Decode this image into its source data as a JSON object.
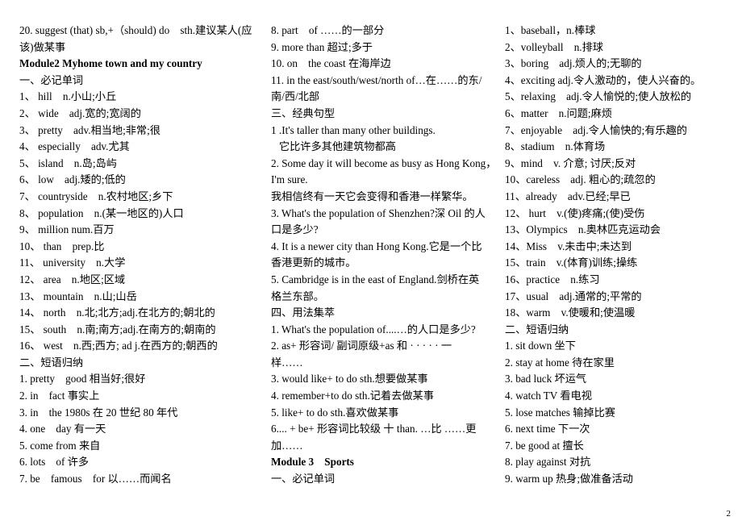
{
  "document": {
    "page_number": "2",
    "columns": [
      {
        "id": "column-left",
        "lines": [
          {
            "text": "20. suggest (that) sb,+（should) do    sth.建议某人(应",
            "bold": false
          },
          {
            "text": "该)做某事",
            "bold": false
          },
          {
            "text": "Module2 Myhome town and my country",
            "bold": true
          },
          {
            "text": "一、必记单词",
            "bold": false
          },
          {
            "text": "1、 hill    n.小山;小丘",
            "bold": false
          },
          {
            "text": "2、 wide    adj.宽的;宽阔的",
            "bold": false
          },
          {
            "text": "3、 pretty    adv.相当地;非常;很",
            "bold": false
          },
          {
            "text": "4、 especially    adv.尤其",
            "bold": false
          },
          {
            "text": "5、 island    n.岛;岛屿",
            "bold": false
          },
          {
            "text": "6、 low    adj.矮的;低的",
            "bold": false
          },
          {
            "text": "7、 countryside    n.农村地区;乡下",
            "bold": false
          },
          {
            "text": "8、 population    n.(某一地区的)人口",
            "bold": false
          },
          {
            "text": "9、 million num.百万",
            "bold": false
          },
          {
            "text": "10、 than    prep.比",
            "bold": false
          },
          {
            "text": "11、 university    n.大学",
            "bold": false
          },
          {
            "text": "12、 area    n.地区;区域",
            "bold": false
          },
          {
            "text": "13、 mountain    n.山;山岳",
            "bold": false
          },
          {
            "text": "14、 north    n.北;北方;adj.在北方的;朝北的",
            "bold": false
          },
          {
            "text": "15、 south    n.南;南方;adj.在南方的;朝南的",
            "bold": false
          },
          {
            "text": "16、 west    n.西;西方; ad j.在西方的;朝西的",
            "bold": false
          },
          {
            "text": "二、短语归纳",
            "bold": false
          },
          {
            "text": "1. pretty    good 相当好;很好",
            "bold": false
          },
          {
            "text": "2. in    fact 事实上",
            "bold": false
          },
          {
            "text": "3. in    the 1980s 在 20 世纪 80 年代",
            "bold": false
          },
          {
            "text": "4. one    day 有一天",
            "bold": false
          },
          {
            "text": "5. come from 来自",
            "bold": false
          },
          {
            "text": "6. lots    of 许多",
            "bold": false
          },
          {
            "text": "7. be    famous    for 以……而闻名",
            "bold": false
          }
        ]
      },
      {
        "id": "column-middle",
        "lines": [
          {
            "text": "8. part    of ……的一部分",
            "bold": false
          },
          {
            "text": "9. more than 超过;多于",
            "bold": false
          },
          {
            "text": "10. on    the coast 在海岸边",
            "bold": false
          },
          {
            "text": "11. in the east/south/west/north of…在……的东/",
            "bold": false
          },
          {
            "text": "南/西/北部",
            "bold": false
          },
          {
            "text": "三、经典句型",
            "bold": false
          },
          {
            "text": "1 .It's taller than many other buildings.",
            "bold": false
          },
          {
            "text": "   它比许多其他建筑物都高",
            "bold": false
          },
          {
            "text": "2. Some day it will become as busy as Hong Kong，",
            "bold": false
          },
          {
            "text": "I'm sure.",
            "bold": false
          },
          {
            "text": "我相信终有一天它会变得和香港一样繁华。",
            "bold": false
          },
          {
            "text": "3. What's the population of Shenzhen?深 Oil 的人",
            "bold": false
          },
          {
            "text": "口是多少?",
            "bold": false
          },
          {
            "text": "4. It is a newer city than Hong Kong.它是一个比",
            "bold": false
          },
          {
            "text": "香港更新的城市。",
            "bold": false
          },
          {
            "text": "5. Cambridge is in the east of England.剑桥在英",
            "bold": false
          },
          {
            "text": "格兰东部。",
            "bold": false
          },
          {
            "text": "四、用法集萃",
            "bold": false
          },
          {
            "text": "1. What's the population of....…的人口是多少?",
            "bold": false
          },
          {
            "text": "2. as+ 形容词/ 副词原级+as 和 · · · · · 一",
            "bold": false
          },
          {
            "text": "样……",
            "bold": false
          },
          {
            "text": "3. would like+ to do sth.想要做某事",
            "bold": false
          },
          {
            "text": "4. remember+to do sth.记着去做某事",
            "bold": false
          },
          {
            "text": "5. like+ to do sth.喜欢做某事",
            "bold": false
          },
          {
            "text": "6.... + be+ 形容词比较级 十 than. …比 ……更",
            "bold": false
          },
          {
            "text": "加……",
            "bold": false
          },
          {
            "text": "Module 3    Sports",
            "bold": true
          },
          {
            "text": "一、必记单词",
            "bold": false
          }
        ]
      },
      {
        "id": "column-right",
        "lines": [
          {
            "text": "1、baseball，n.棒球",
            "bold": false
          },
          {
            "text": "2、volleyball    n.排球",
            "bold": false
          },
          {
            "text": "3、boring    adj.烦人的;无聊的",
            "bold": false
          },
          {
            "text": "4、exciting adj.令人激动的，使人兴奋的。",
            "bold": false
          },
          {
            "text": "5、relaxing    adj.令人愉悦的;使人放松的",
            "bold": false
          },
          {
            "text": "6、matter    n.问题;麻烦",
            "bold": false
          },
          {
            "text": "7、enjoyable    adj.令人愉快的;有乐趣的",
            "bold": false
          },
          {
            "text": "8、stadium    n.体育场",
            "bold": false
          },
          {
            "text": "9、mind    v. 介意; 讨厌;反对",
            "bold": false
          },
          {
            "text": "10、careless    adj. 粗心的;疏忽的",
            "bold": false
          },
          {
            "text": "11、already    adv.已经;早已",
            "bold": false
          },
          {
            "text": "12、 hurt    v.(使)疼痛;(使)受伤",
            "bold": false
          },
          {
            "text": "13、Olympics    n.奥林匹克运动会",
            "bold": false
          },
          {
            "text": "14、Miss    v.未击中;未达到",
            "bold": false
          },
          {
            "text": "15、train    v.(体育)训练;操练",
            "bold": false
          },
          {
            "text": "16、practice    n.练习",
            "bold": false
          },
          {
            "text": "17、usual    adj.通常的;平常的",
            "bold": false
          },
          {
            "text": "18、warm    v.使暖和;使温暖",
            "bold": false
          },
          {
            "text": "二、短语归纳",
            "bold": false
          },
          {
            "text": "1. sit down 坐下",
            "bold": false
          },
          {
            "text": "2. stay at home 待在家里",
            "bold": false
          },
          {
            "text": "3. bad luck 坏运气",
            "bold": false
          },
          {
            "text": "4. watch TV 看电视",
            "bold": false
          },
          {
            "text": "5. lose matches 输掉比赛",
            "bold": false
          },
          {
            "text": "6. next time 下一次",
            "bold": false
          },
          {
            "text": "7. be good at 擅长",
            "bold": false
          },
          {
            "text": "8. play against 对抗",
            "bold": false
          },
          {
            "text": "9. warm up 热身;做准备活动",
            "bold": false
          }
        ]
      }
    ]
  }
}
